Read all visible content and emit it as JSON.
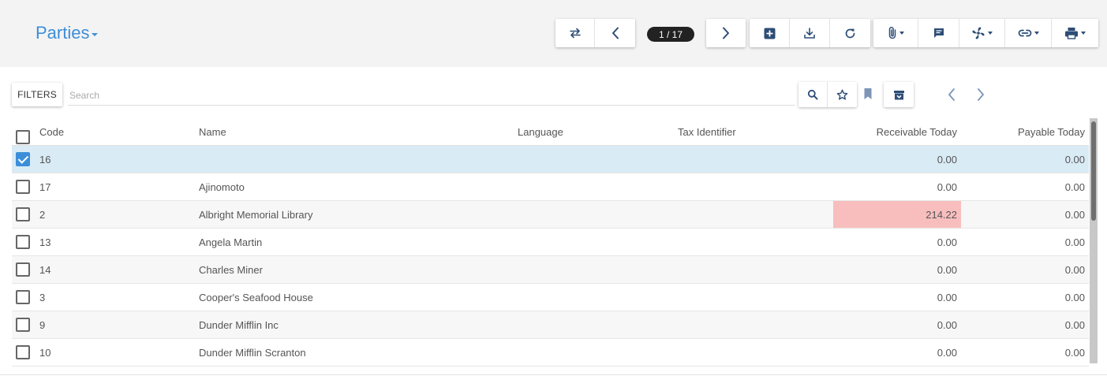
{
  "app": {
    "title": "Parties"
  },
  "toolbar": {
    "record_position": "1 / 17"
  },
  "search": {
    "filters_label": "FILTERS",
    "placeholder": "Search"
  },
  "colors": {
    "accent": "#3c8ed8",
    "icon": "#2d4d75",
    "selected_row": "#d9ebf5",
    "highlight": "#f8bebe"
  },
  "icons": {
    "toolbar": [
      "switch-view-icon",
      "previous-record-icon",
      "next-record-icon",
      "new-record-icon",
      "save-icon",
      "reload-icon",
      "attachment-icon",
      "note-icon",
      "action-icon",
      "relate-icon",
      "print-icon"
    ],
    "search": [
      "search-icon",
      "star-icon",
      "bookmark-icon",
      "archive-icon",
      "previous-page-icon",
      "next-page-icon"
    ]
  },
  "table": {
    "columns": [
      "Code",
      "Name",
      "Language",
      "Tax Identifier",
      "Receivable Today",
      "Payable Today"
    ],
    "rows": [
      {
        "code": "16",
        "name": "",
        "language": "",
        "tax_identifier": "",
        "receivable": "0.00",
        "payable": "0.00",
        "checked": true,
        "highlight": false
      },
      {
        "code": "17",
        "name": "Ajinomoto",
        "language": "",
        "tax_identifier": "",
        "receivable": "0.00",
        "payable": "0.00",
        "checked": false,
        "highlight": false
      },
      {
        "code": "2",
        "name": "Albright Memorial Library",
        "language": "",
        "tax_identifier": "",
        "receivable": "214.22",
        "payable": "0.00",
        "checked": false,
        "highlight": true
      },
      {
        "code": "13",
        "name": "Angela Martin",
        "language": "",
        "tax_identifier": "",
        "receivable": "0.00",
        "payable": "0.00",
        "checked": false,
        "highlight": false
      },
      {
        "code": "14",
        "name": "Charles Miner",
        "language": "",
        "tax_identifier": "",
        "receivable": "0.00",
        "payable": "0.00",
        "checked": false,
        "highlight": false
      },
      {
        "code": "3",
        "name": "Cooper's Seafood House",
        "language": "",
        "tax_identifier": "",
        "receivable": "0.00",
        "payable": "0.00",
        "checked": false,
        "highlight": false
      },
      {
        "code": "9",
        "name": "Dunder Mifflin Inc",
        "language": "",
        "tax_identifier": "",
        "receivable": "0.00",
        "payable": "0.00",
        "checked": false,
        "highlight": false
      },
      {
        "code": "10",
        "name": "Dunder Mifflin Scranton",
        "language": "",
        "tax_identifier": "",
        "receivable": "0.00",
        "payable": "0.00",
        "checked": false,
        "highlight": false
      }
    ]
  }
}
